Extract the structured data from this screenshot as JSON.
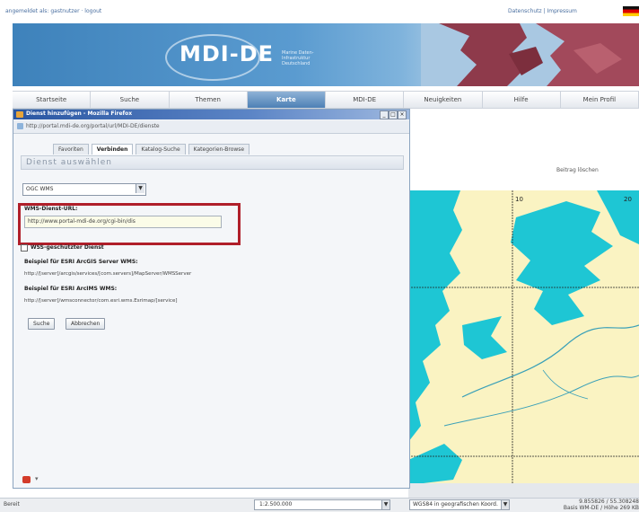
{
  "topbar": {
    "left_text": "angemeldet als: gastnutzer · logout",
    "right_text": "Datenschutz | Impressum",
    "flag_colors": [
      "#111111",
      "#dd0000",
      "#ffcc00"
    ]
  },
  "banner": {
    "logo_text": "MDI-DE",
    "logo_sub": "Marine Daten-Infrastruktur Deutschland"
  },
  "nav": {
    "items": [
      "Startseite",
      "Suche",
      "Themen",
      "Karte",
      "MDI-DE",
      "Neuigkeiten",
      "Hilfe",
      "Mein Profil"
    ],
    "active_index": 3
  },
  "dialog": {
    "title": "Dienst hinzufügen - Mozilla Firefox",
    "window_buttons": [
      "_",
      "□",
      "×"
    ],
    "address": "http://portal.mdi-de.org/portal/url/MDI-DE/dienste",
    "tabs": [
      "Favoriten",
      "Verbinden",
      "Katalog-Suche",
      "Kategorien-Browse"
    ],
    "active_tab": 1,
    "panel_title": "Dienst auswählen",
    "service_type": "OGC WMS",
    "url_label": "WMS-Dienst-URL:",
    "url_value": "http://www.portal-mdi-de.org/cgi-bin/dis",
    "checkbox_label": "WSS-geschützter Dienst",
    "example1_head": "Beispiel für ESRI ArcGIS Server WMS:",
    "example1_url": "http://[server]/arcgis/services/[com.servers]/MapServer/WMSServer",
    "example2_head": "Beispiel für ESRI ArcIMS WMS:",
    "example2_url": "http://[server]/wmsconnector/com.esri.wms.Esrimap/[service]",
    "buttons": [
      "Suche",
      "Abbrechen"
    ]
  },
  "map": {
    "header_text": "Beitrag löschen",
    "water_color": "#1ec6d4",
    "land_color": "#faf3c2",
    "grid_labels": [
      "10",
      "20"
    ]
  },
  "statusbar": {
    "left": "Bereit",
    "scale": "1:2.500.000",
    "projection": "WGS84 in geografischen Koord.",
    "coordinates": "9.855826 / 55.308248",
    "coordinates_sub": "Basis WM-DE / Höhe 269 KB"
  }
}
